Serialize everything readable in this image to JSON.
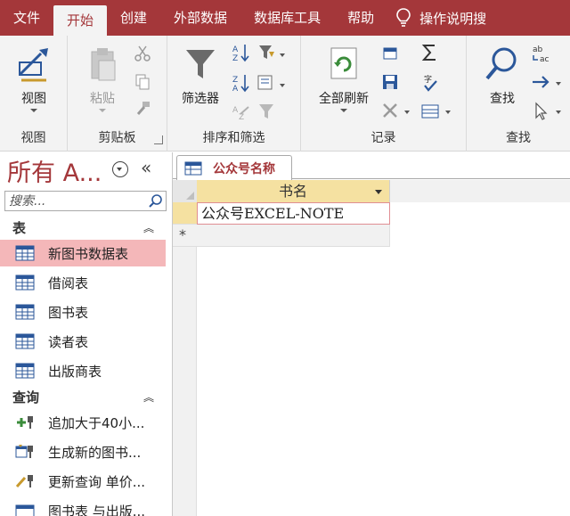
{
  "ribbon_tabs": [
    "文件",
    "开始",
    "创建",
    "外部数据",
    "数据库工具",
    "帮助"
  ],
  "tell_me": "操作说明搜",
  "groups": {
    "view": {
      "button": "视图",
      "label": "视图"
    },
    "clipboard": {
      "paste": "粘贴",
      "label": "剪贴板"
    },
    "sort_filter": {
      "filter": "筛选器",
      "label": "排序和筛选"
    },
    "records": {
      "refresh": "全部刷新",
      "label": "记录"
    },
    "find": {
      "find": "查找",
      "label": "查找"
    }
  },
  "nav": {
    "title": "所有 A...",
    "search_placeholder": "搜索...",
    "tables_header": "表",
    "tables": [
      "新图书数据表",
      "借阅表",
      "图书表",
      "读者表",
      "出版商表"
    ],
    "queries_header": "查询",
    "queries": [
      "追加大于40小...",
      "生成新的图书...",
      "更新查询 单价...",
      "图书表 与出版..."
    ],
    "selected_index": 0
  },
  "document": {
    "tab_title": "公众号名称",
    "column_header": "书名",
    "rows": [
      "公众号EXCEL-NOTE"
    ],
    "new_row_marker": "*"
  },
  "colors": {
    "accent": "#a4373a",
    "ribbon_bg": "#f3f3f3",
    "selected_nav": "#f4b7b9",
    "column_header_bg": "#f5e1a1"
  },
  "icons": {
    "view": "design-view-icon",
    "paste": "paste-icon",
    "cut": "scissors-icon",
    "copy": "copy-icon",
    "format_painter": "brush-icon",
    "filter": "funnel-icon",
    "sort_asc": "sort-ascending-icon",
    "sort_desc": "sort-descending-icon",
    "refresh": "refresh-icon",
    "sum": "sigma-icon",
    "find": "magnifier-icon",
    "replace": "replace-icon",
    "goto": "arrow-right-icon",
    "select": "cursor-icon"
  }
}
